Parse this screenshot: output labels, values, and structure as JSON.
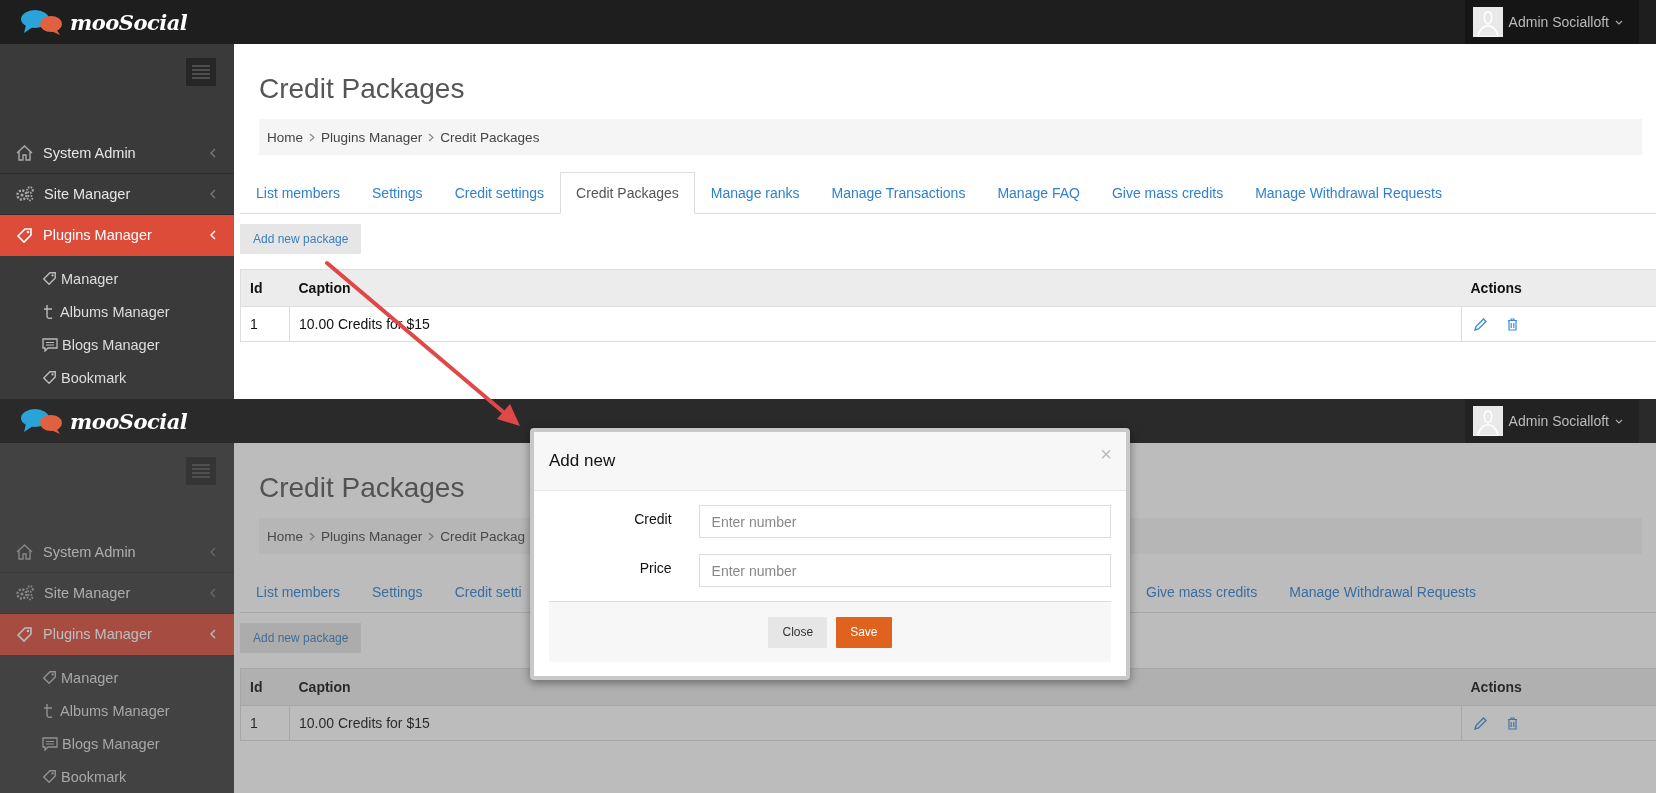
{
  "screens": [
    {
      "brand": "mooSocial",
      "user": "Admin Socialloft",
      "dimmed": false,
      "sidebar": [
        {
          "label": "System Admin",
          "selected": false
        },
        {
          "label": "Site Manager",
          "selected": false
        },
        {
          "label": "Plugins Manager",
          "selected": true
        }
      ],
      "sub_items": [
        "Manager",
        "Albums Manager",
        "Blogs Manager",
        "Bookmark"
      ],
      "title": "Credit Packages",
      "breadcrumb": [
        "Home",
        "Plugins Manager",
        "Credit Packages"
      ],
      "tabs": [
        {
          "label": "List members",
          "selected": false
        },
        {
          "label": "Settings",
          "selected": false
        },
        {
          "label": "Credit settings",
          "selected": false
        },
        {
          "label": "Credit Packages",
          "selected": true
        },
        {
          "label": "Manage ranks",
          "selected": false
        },
        {
          "label": "Manage Transactions",
          "selected": false
        },
        {
          "label": "Manage FAQ",
          "selected": false
        },
        {
          "label": "Give mass credits",
          "selected": false
        },
        {
          "label": "Manage Withdrawal Requests",
          "selected": false
        }
      ],
      "add_button": "Add new package",
      "table": {
        "columns": [
          "Id",
          "Caption",
          "Actions"
        ],
        "rows": [
          {
            "id": "1",
            "caption": "10.00 Credits for $15"
          }
        ]
      }
    },
    {
      "brand": "mooSocial",
      "user": "Admin Socialloft",
      "dimmed": true,
      "sidebar": [
        {
          "label": "System Admin",
          "selected": false
        },
        {
          "label": "Site Manager",
          "selected": false
        },
        {
          "label": "Plugins Manager",
          "selected": true
        }
      ],
      "sub_items": [
        "Manager",
        "Albums Manager",
        "Blogs Manager",
        "Bookmark"
      ],
      "title": "Credit Packages",
      "breadcrumb": [
        "Home",
        "Plugins Manager",
        "Credit Packag"
      ],
      "tabs": [
        {
          "label": "List members",
          "selected": false
        },
        {
          "label": "Settings",
          "selected": false
        },
        {
          "label": "Credit setti",
          "selected": false
        }
      ],
      "tabs_after_dialog": [
        {
          "label": "Give mass credits",
          "selected": false
        },
        {
          "label": "Manage Withdrawal Requests",
          "selected": false
        }
      ],
      "add_button": "Add new package",
      "table": {
        "columns": [
          "Id",
          "Caption",
          "Actions"
        ],
        "rows": [
          {
            "id": "1",
            "caption": "10.00 Credits for $15"
          }
        ]
      }
    }
  ],
  "dialog": {
    "title": "Add new",
    "close": "×",
    "fields": [
      {
        "label": "Credit",
        "placeholder": "Enter number"
      },
      {
        "label": "Price",
        "placeholder": "Enter number"
      }
    ],
    "buttons": [
      {
        "label": "Close",
        "kind": "default"
      },
      {
        "label": "Save",
        "kind": "primary"
      }
    ]
  }
}
